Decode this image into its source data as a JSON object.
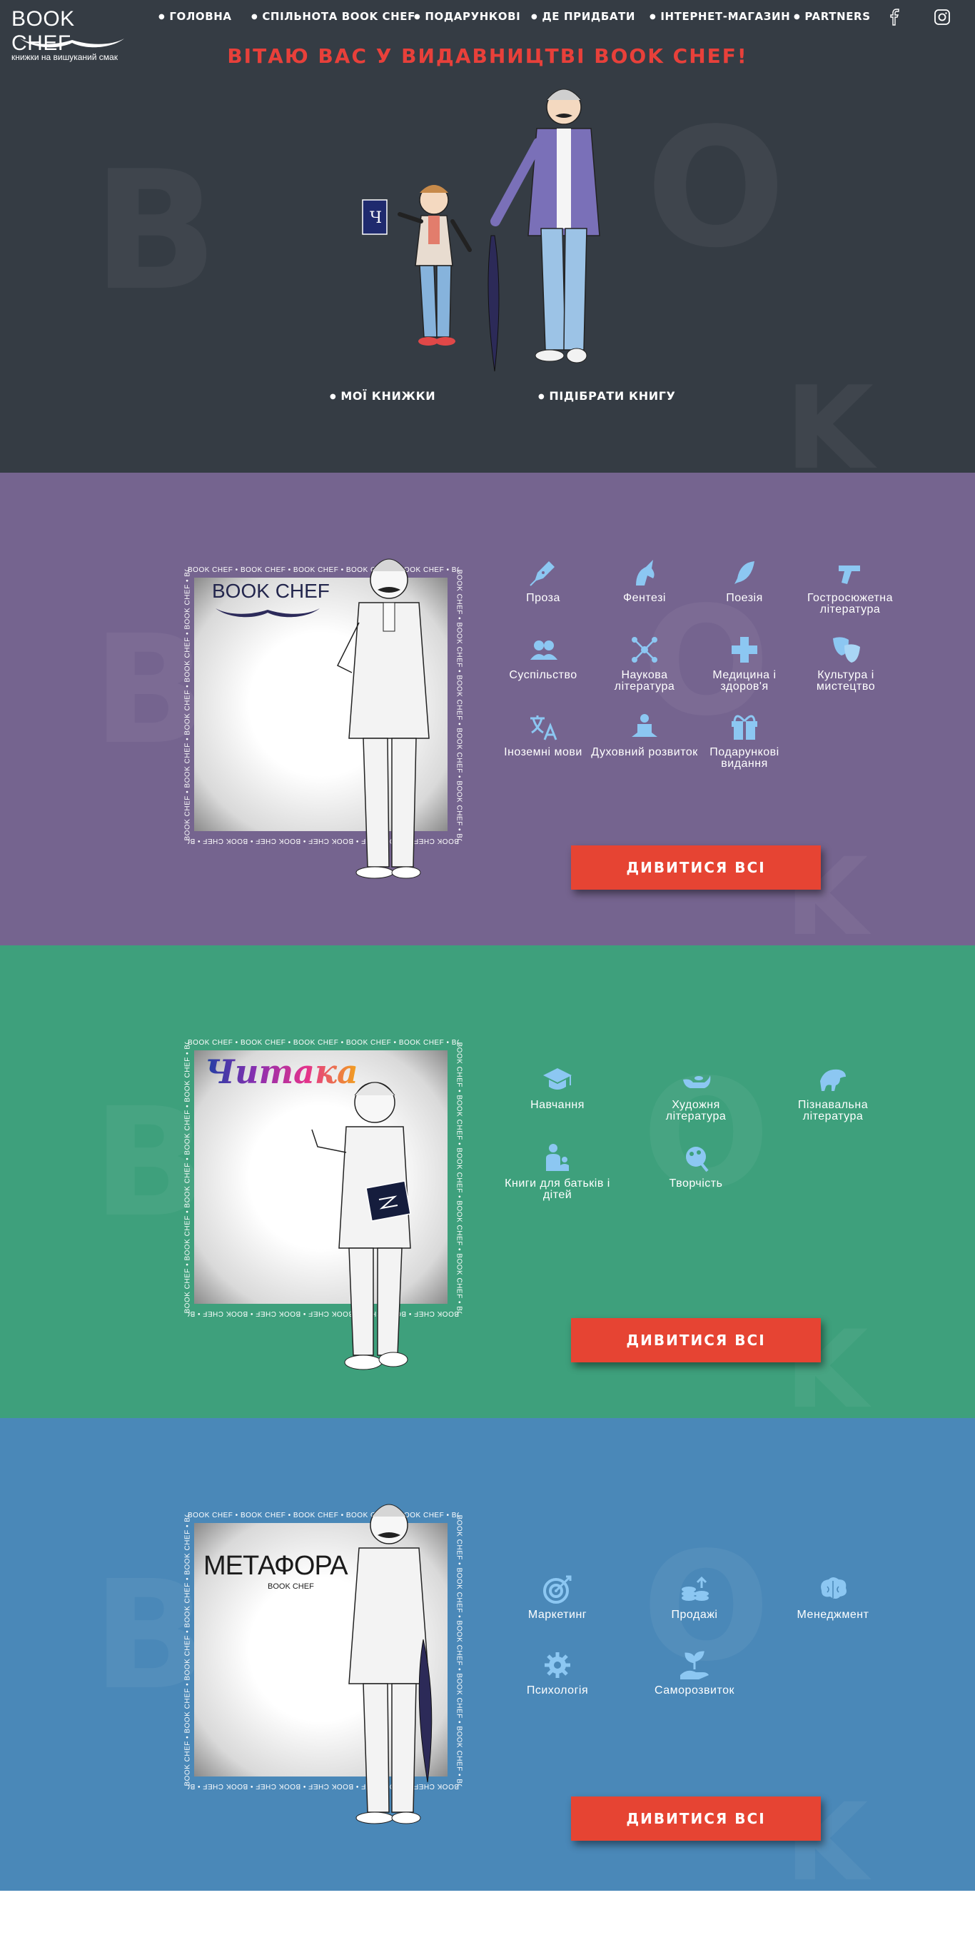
{
  "header": {
    "logo_title": "BOOK CHEF",
    "logo_tagline": "книжки на вишуканий смак",
    "nav": [
      {
        "label": "ГОЛОВНА"
      },
      {
        "label": "СПІЛЬНОТА BOOK CHEF"
      },
      {
        "label": "ПОДАРУНКОВІ"
      },
      {
        "label": "ДЕ ПРИДБАТИ"
      },
      {
        "label": "ІНТЕРНЕТ-МАГАЗИН"
      },
      {
        "label": "PARTNERS"
      }
    ],
    "social": [
      "facebook-icon",
      "instagram-icon"
    ]
  },
  "hero": {
    "title": "ВІТАЮ ВАС У ВИДАВНИЦТВІ BOOK CHEF!",
    "book_letter": "Ч",
    "links": [
      {
        "label": "МОЇ КНИЖКИ"
      },
      {
        "label": "ПІДІБРАТИ КНИГУ"
      }
    ]
  },
  "frame_strip_text": "BOOK CHEF • BOOK CHEF • BOOK CHEF • BOOK CHEF • BOOK CHEF • BOOK CHEF •",
  "sections": {
    "bookchef": {
      "brand_label": "BOOK CHEF",
      "categories": [
        {
          "label": "Проза",
          "icon": "pen-nib-icon"
        },
        {
          "label": "Фентезі",
          "icon": "unicorn-icon"
        },
        {
          "label": "Поезія",
          "icon": "feather-icon"
        },
        {
          "label": "Гостросюжетна література",
          "icon": "pistol-icon"
        },
        {
          "label": "Суспільство",
          "icon": "users-icon"
        },
        {
          "label": "Наукова література",
          "icon": "molecule-icon"
        },
        {
          "label": "Медицина і здоров'я",
          "icon": "medical-cross-icon"
        },
        {
          "label": "Культура і мистецтво",
          "icon": "theater-masks-icon"
        },
        {
          "label": "Іноземні мови",
          "icon": "translate-icon"
        },
        {
          "label": "Духовний розвиток",
          "icon": "meditation-icon"
        },
        {
          "label": "Подарункові видання",
          "icon": "gift-icon"
        }
      ],
      "cta": "ДИВИТИСЯ ВСІ"
    },
    "chytaka": {
      "brand_label": "Читака",
      "categories": [
        {
          "label": "Навчання",
          "icon": "graduation-cap-icon"
        },
        {
          "label": "Художня література",
          "icon": "magic-lamp-icon"
        },
        {
          "label": "Пізнавальна література",
          "icon": "dinosaur-icon"
        },
        {
          "label": "Книги для батьків і дітей",
          "icon": "parent-child-icon"
        },
        {
          "label": "Творчість",
          "icon": "creativity-icon"
        }
      ],
      "cta": "ДИВИТИСЯ ВСІ"
    },
    "metafora": {
      "brand_label": "МЕТАФОРА",
      "brand_sub": "BOOK CHEF",
      "categories": [
        {
          "label": "Маркетинг",
          "icon": "target-icon"
        },
        {
          "label": "Продажі",
          "icon": "coins-icon"
        },
        {
          "label": "Менеджмент",
          "icon": "brain-icon"
        },
        {
          "label": "Психологія",
          "icon": "gear-head-icon"
        },
        {
          "label": "Саморозвиток",
          "icon": "seedling-hand-icon"
        }
      ],
      "cta": "ДИВИТИСЯ ВСІ"
    }
  },
  "colors": {
    "hero_bg": "#353c44",
    "bookchef_bg": "#75648f",
    "chytaka_bg": "#3ea07c",
    "metafora_bg": "#4a88b8",
    "accent_red": "#e64433",
    "icon_blue": "#8cc7f2"
  }
}
